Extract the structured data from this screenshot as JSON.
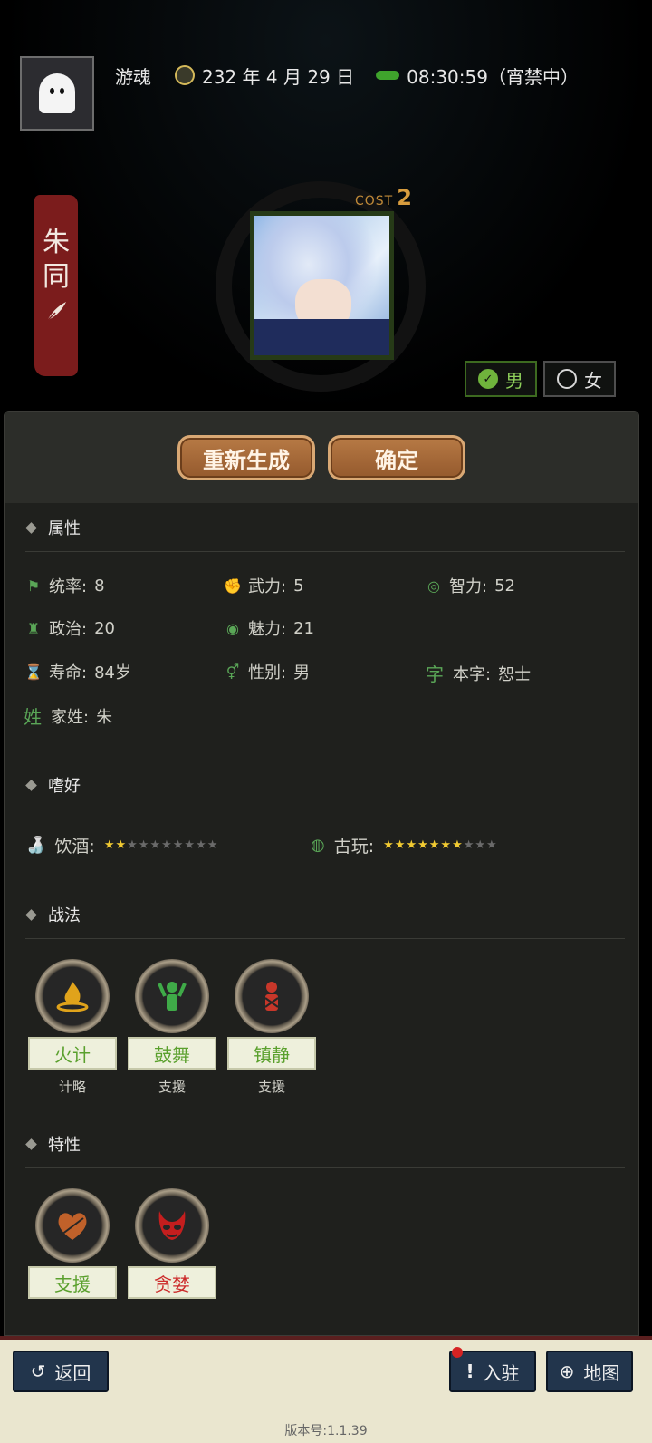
{
  "header": {
    "player_name": "游魂",
    "date": "232 年 4 月 29 日",
    "time": "08:30:59（宵禁中）"
  },
  "character": {
    "name_char1": "朱",
    "name_char2": "同",
    "cost_label": "COST",
    "cost_value": "2"
  },
  "gender": {
    "male_label": "男",
    "female_label": "女",
    "selected": "male"
  },
  "actions": {
    "regenerate_label": "重新生成",
    "confirm_label": "确定"
  },
  "attributes": {
    "title": "属性",
    "items": [
      {
        "label": "统率:",
        "value": "8"
      },
      {
        "label": "武力:",
        "value": "5"
      },
      {
        "label": "智力:",
        "value": "52"
      },
      {
        "label": "政治:",
        "value": "20"
      },
      {
        "label": "魅力:",
        "value": "21"
      },
      {
        "label": "寿命:",
        "value": "84岁"
      },
      {
        "label": "性别:",
        "value": "男"
      },
      {
        "label": "本字:",
        "value": "恕士",
        "icon_char": "字"
      },
      {
        "label": "家姓:",
        "value": "朱",
        "icon_char": "姓"
      }
    ]
  },
  "hobbies": {
    "title": "嗜好",
    "items": [
      {
        "label": "饮酒:",
        "stars": 1.5,
        "max": 10
      },
      {
        "label": "古玩:",
        "stars": 6.5,
        "max": 10
      }
    ]
  },
  "tactics": {
    "title": "战法",
    "items": [
      {
        "name": "火计",
        "type": "计略",
        "color": "#e0a31b",
        "name_color": "#5aa02d"
      },
      {
        "name": "鼓舞",
        "type": "支援",
        "color": "#3faa48",
        "name_color": "#5aa02d"
      },
      {
        "name": "镇静",
        "type": "支援",
        "color": "#c8372a",
        "name_color": "#5aa02d"
      }
    ]
  },
  "traits": {
    "title": "特性",
    "items": [
      {
        "name": "支援",
        "color": "#c0612a",
        "name_color": "#5aa02d"
      },
      {
        "name": "贪婪",
        "color": "#c41e1e",
        "name_color": "#cc2a2a"
      }
    ]
  },
  "footer": {
    "back_label": "返回",
    "settle_label": "入驻",
    "map_label": "地图",
    "version": "版本号:1.1.39"
  }
}
